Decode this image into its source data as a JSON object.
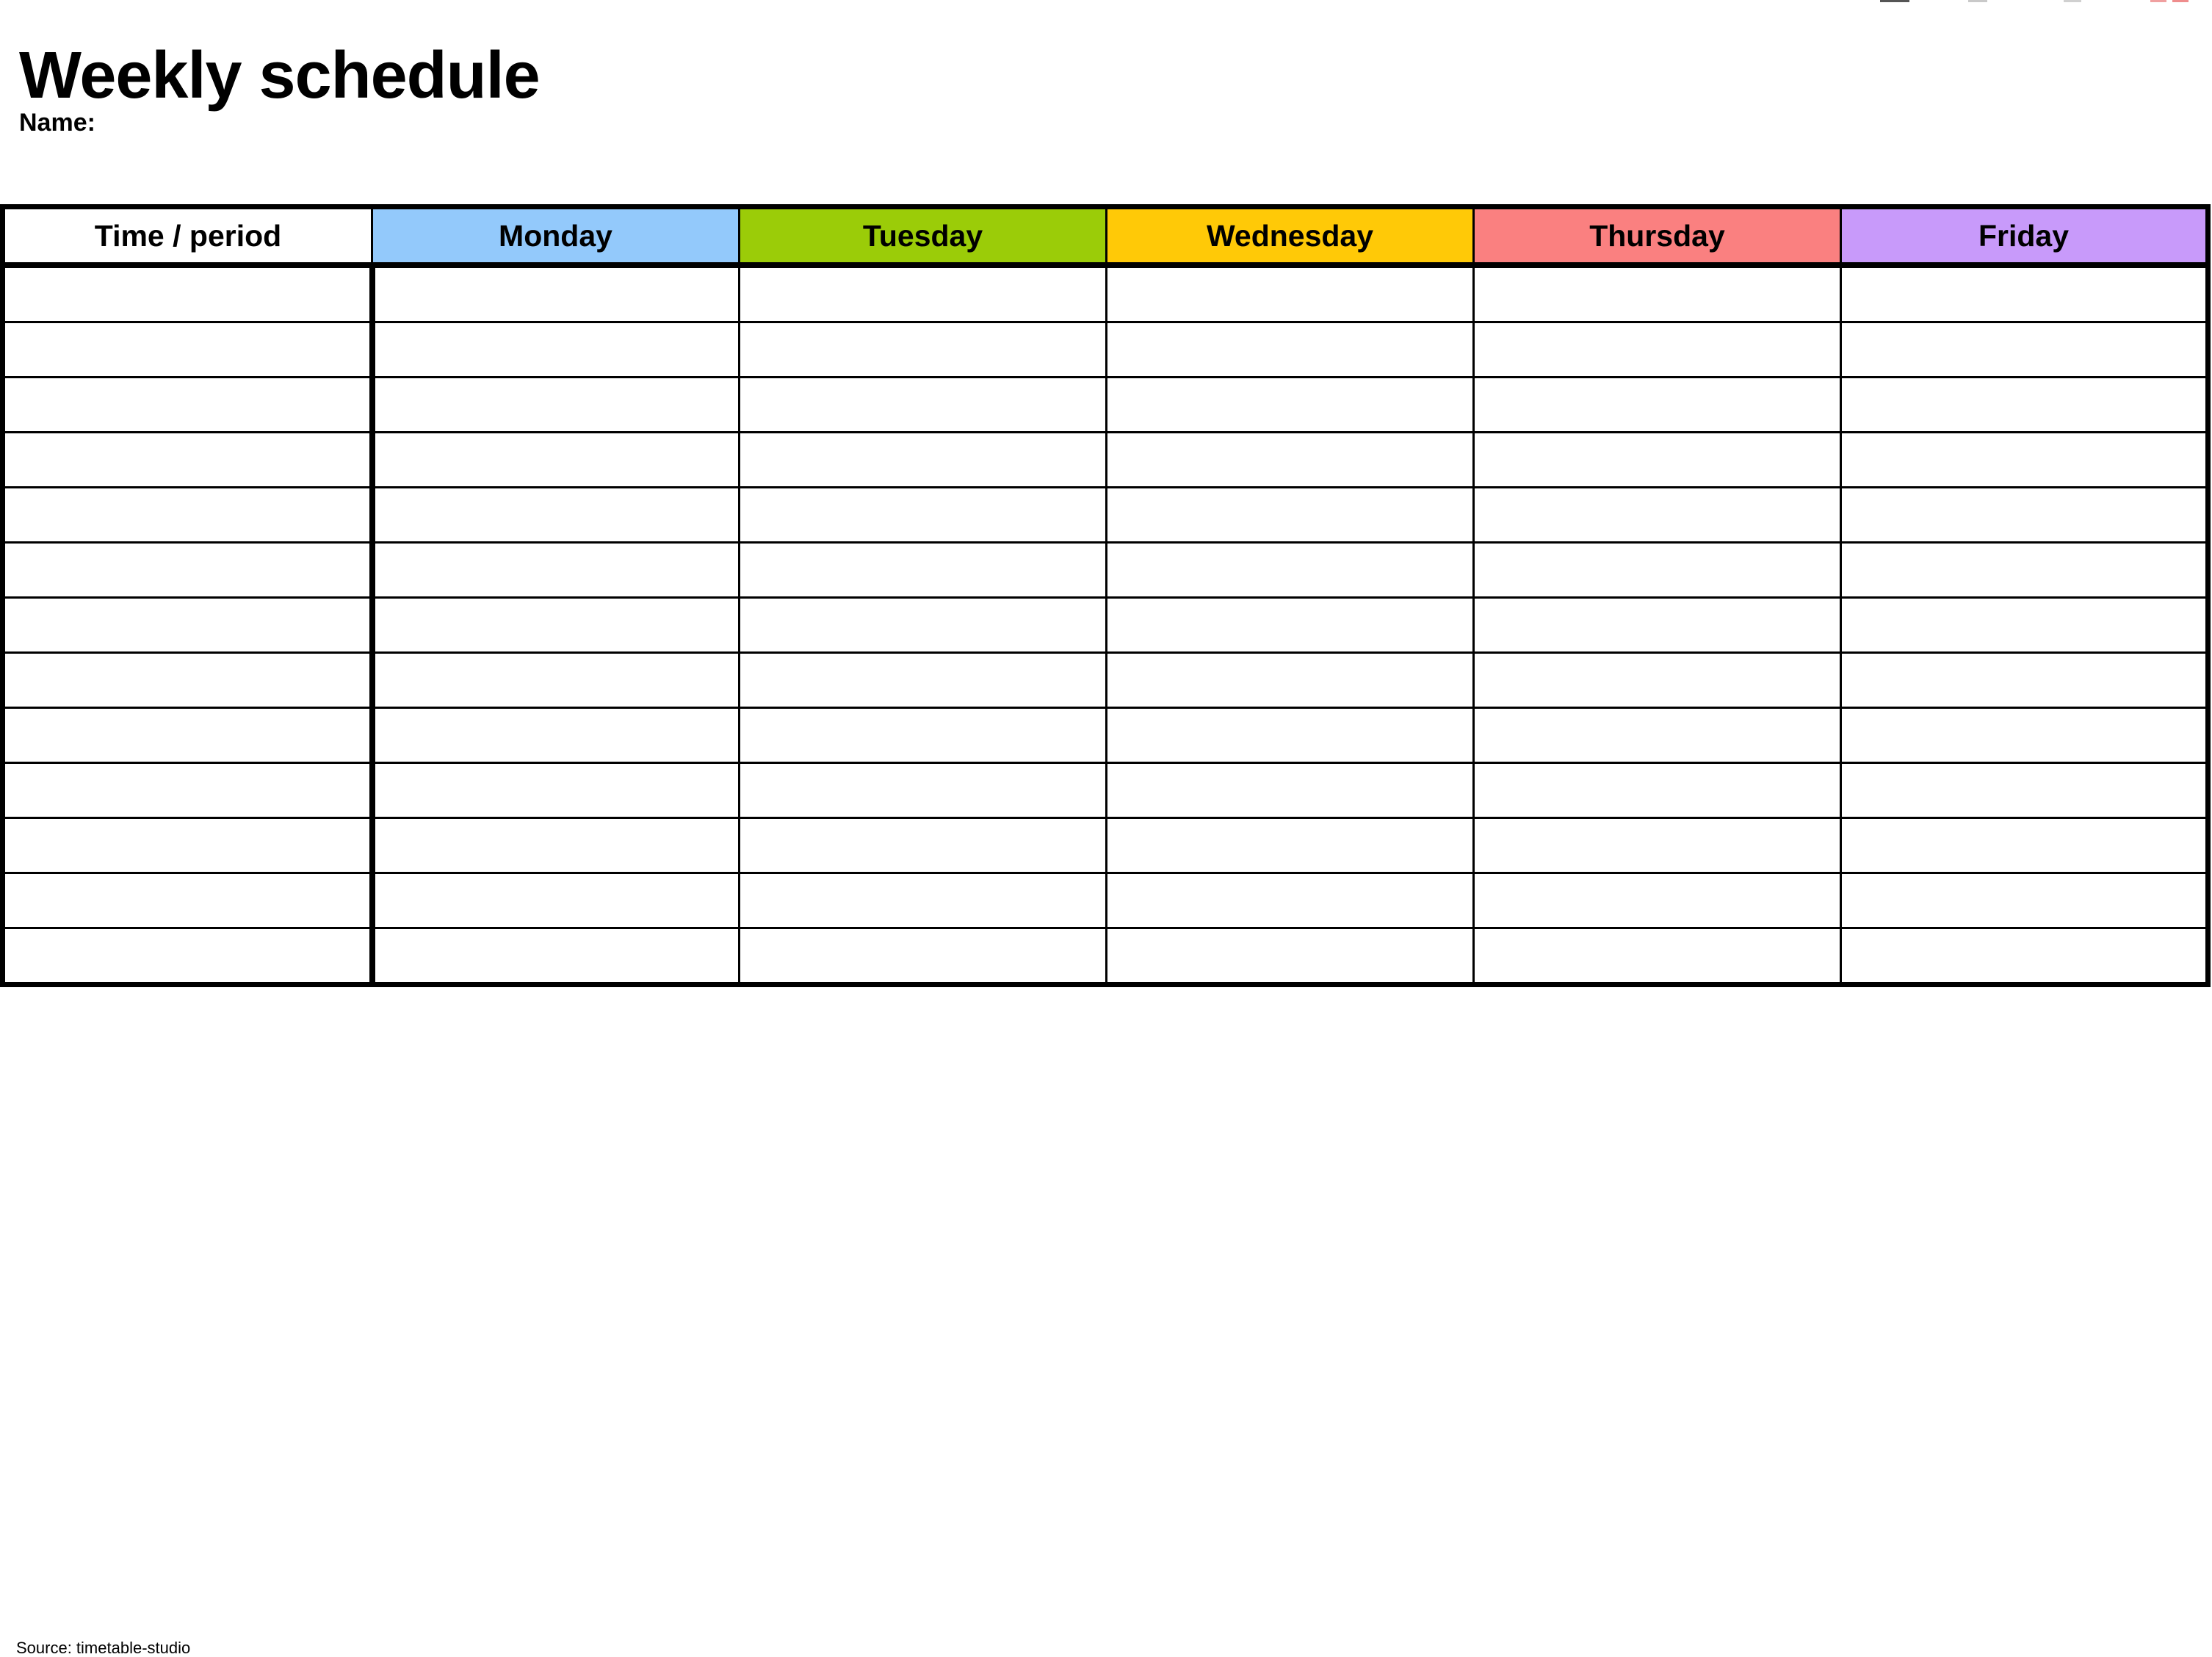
{
  "document": {
    "title": "Weekly schedule",
    "name_label": "Name:",
    "footer_note": "Source: timetable-studio"
  },
  "colors": {
    "page_background": "#ffffff",
    "border": "#000000",
    "text": "#000000",
    "time_header_background": "#ffffff",
    "monday": "#93c9fb",
    "tuesday": "#9bcc08",
    "wednesday": "#ffc907",
    "thursday": "#fa8080",
    "friday": "#c89afa"
  },
  "table": {
    "columns": [
      {
        "id": "time",
        "label": "Time / period",
        "background": "#ffffff"
      },
      {
        "id": "monday",
        "label": "Monday",
        "background": "#93c9fb"
      },
      {
        "id": "tuesday",
        "label": "Tuesday",
        "background": "#9bcc08"
      },
      {
        "id": "wednesday",
        "label": "Wednesday",
        "background": "#ffc907"
      },
      {
        "id": "thursday",
        "label": "Thursday",
        "background": "#fa8080"
      },
      {
        "id": "friday",
        "label": "Friday",
        "background": "#c89afa"
      }
    ],
    "row_count": 13,
    "rows": [
      {
        "time": "",
        "monday": "",
        "tuesday": "",
        "wednesday": "",
        "thursday": "",
        "friday": ""
      },
      {
        "time": "",
        "monday": "",
        "tuesday": "",
        "wednesday": "",
        "thursday": "",
        "friday": ""
      },
      {
        "time": "",
        "monday": "",
        "tuesday": "",
        "wednesday": "",
        "thursday": "",
        "friday": ""
      },
      {
        "time": "",
        "monday": "",
        "tuesday": "",
        "wednesday": "",
        "thursday": "",
        "friday": ""
      },
      {
        "time": "",
        "monday": "",
        "tuesday": "",
        "wednesday": "",
        "thursday": "",
        "friday": ""
      },
      {
        "time": "",
        "monday": "",
        "tuesday": "",
        "wednesday": "",
        "thursday": "",
        "friday": ""
      },
      {
        "time": "",
        "monday": "",
        "tuesday": "",
        "wednesday": "",
        "thursday": "",
        "friday": ""
      },
      {
        "time": "",
        "monday": "",
        "tuesday": "",
        "wednesday": "",
        "thursday": "",
        "friday": ""
      },
      {
        "time": "",
        "monday": "",
        "tuesday": "",
        "wednesday": "",
        "thursday": "",
        "friday": ""
      },
      {
        "time": "",
        "monday": "",
        "tuesday": "",
        "wednesday": "",
        "thursday": "",
        "friday": ""
      },
      {
        "time": "",
        "monday": "",
        "tuesday": "",
        "wednesday": "",
        "thursday": "",
        "friday": ""
      },
      {
        "time": "",
        "monday": "",
        "tuesday": "",
        "wednesday": "",
        "thursday": "",
        "friday": ""
      },
      {
        "time": "",
        "monday": "",
        "tuesday": "",
        "wednesday": "",
        "thursday": "",
        "friday": ""
      }
    ]
  }
}
